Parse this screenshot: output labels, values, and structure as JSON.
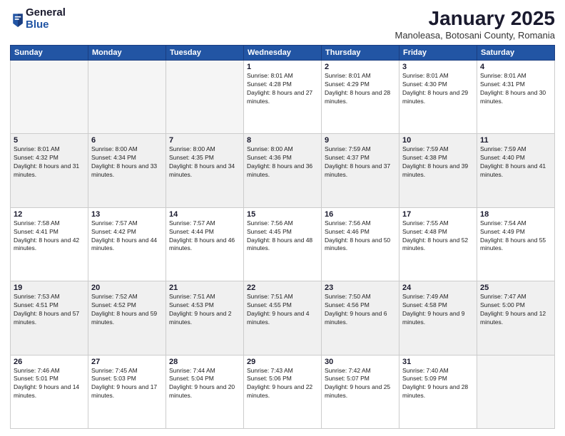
{
  "logo": {
    "general": "General",
    "blue": "Blue"
  },
  "header": {
    "month": "January 2025",
    "location": "Manoleasa, Botosani County, Romania"
  },
  "weekdays": [
    "Sunday",
    "Monday",
    "Tuesday",
    "Wednesday",
    "Thursday",
    "Friday",
    "Saturday"
  ],
  "weeks": [
    [
      {
        "day": "",
        "info": ""
      },
      {
        "day": "",
        "info": ""
      },
      {
        "day": "",
        "info": ""
      },
      {
        "day": "1",
        "info": "Sunrise: 8:01 AM\nSunset: 4:28 PM\nDaylight: 8 hours and 27 minutes."
      },
      {
        "day": "2",
        "info": "Sunrise: 8:01 AM\nSunset: 4:29 PM\nDaylight: 8 hours and 28 minutes."
      },
      {
        "day": "3",
        "info": "Sunrise: 8:01 AM\nSunset: 4:30 PM\nDaylight: 8 hours and 29 minutes."
      },
      {
        "day": "4",
        "info": "Sunrise: 8:01 AM\nSunset: 4:31 PM\nDaylight: 8 hours and 30 minutes."
      }
    ],
    [
      {
        "day": "5",
        "info": "Sunrise: 8:01 AM\nSunset: 4:32 PM\nDaylight: 8 hours and 31 minutes."
      },
      {
        "day": "6",
        "info": "Sunrise: 8:00 AM\nSunset: 4:34 PM\nDaylight: 8 hours and 33 minutes."
      },
      {
        "day": "7",
        "info": "Sunrise: 8:00 AM\nSunset: 4:35 PM\nDaylight: 8 hours and 34 minutes."
      },
      {
        "day": "8",
        "info": "Sunrise: 8:00 AM\nSunset: 4:36 PM\nDaylight: 8 hours and 36 minutes."
      },
      {
        "day": "9",
        "info": "Sunrise: 7:59 AM\nSunset: 4:37 PM\nDaylight: 8 hours and 37 minutes."
      },
      {
        "day": "10",
        "info": "Sunrise: 7:59 AM\nSunset: 4:38 PM\nDaylight: 8 hours and 39 minutes."
      },
      {
        "day": "11",
        "info": "Sunrise: 7:59 AM\nSunset: 4:40 PM\nDaylight: 8 hours and 41 minutes."
      }
    ],
    [
      {
        "day": "12",
        "info": "Sunrise: 7:58 AM\nSunset: 4:41 PM\nDaylight: 8 hours and 42 minutes."
      },
      {
        "day": "13",
        "info": "Sunrise: 7:57 AM\nSunset: 4:42 PM\nDaylight: 8 hours and 44 minutes."
      },
      {
        "day": "14",
        "info": "Sunrise: 7:57 AM\nSunset: 4:44 PM\nDaylight: 8 hours and 46 minutes."
      },
      {
        "day": "15",
        "info": "Sunrise: 7:56 AM\nSunset: 4:45 PM\nDaylight: 8 hours and 48 minutes."
      },
      {
        "day": "16",
        "info": "Sunrise: 7:56 AM\nSunset: 4:46 PM\nDaylight: 8 hours and 50 minutes."
      },
      {
        "day": "17",
        "info": "Sunrise: 7:55 AM\nSunset: 4:48 PM\nDaylight: 8 hours and 52 minutes."
      },
      {
        "day": "18",
        "info": "Sunrise: 7:54 AM\nSunset: 4:49 PM\nDaylight: 8 hours and 55 minutes."
      }
    ],
    [
      {
        "day": "19",
        "info": "Sunrise: 7:53 AM\nSunset: 4:51 PM\nDaylight: 8 hours and 57 minutes."
      },
      {
        "day": "20",
        "info": "Sunrise: 7:52 AM\nSunset: 4:52 PM\nDaylight: 8 hours and 59 minutes."
      },
      {
        "day": "21",
        "info": "Sunrise: 7:51 AM\nSunset: 4:53 PM\nDaylight: 9 hours and 2 minutes."
      },
      {
        "day": "22",
        "info": "Sunrise: 7:51 AM\nSunset: 4:55 PM\nDaylight: 9 hours and 4 minutes."
      },
      {
        "day": "23",
        "info": "Sunrise: 7:50 AM\nSunset: 4:56 PM\nDaylight: 9 hours and 6 minutes."
      },
      {
        "day": "24",
        "info": "Sunrise: 7:49 AM\nSunset: 4:58 PM\nDaylight: 9 hours and 9 minutes."
      },
      {
        "day": "25",
        "info": "Sunrise: 7:47 AM\nSunset: 5:00 PM\nDaylight: 9 hours and 12 minutes."
      }
    ],
    [
      {
        "day": "26",
        "info": "Sunrise: 7:46 AM\nSunset: 5:01 PM\nDaylight: 9 hours and 14 minutes."
      },
      {
        "day": "27",
        "info": "Sunrise: 7:45 AM\nSunset: 5:03 PM\nDaylight: 9 hours and 17 minutes."
      },
      {
        "day": "28",
        "info": "Sunrise: 7:44 AM\nSunset: 5:04 PM\nDaylight: 9 hours and 20 minutes."
      },
      {
        "day": "29",
        "info": "Sunrise: 7:43 AM\nSunset: 5:06 PM\nDaylight: 9 hours and 22 minutes."
      },
      {
        "day": "30",
        "info": "Sunrise: 7:42 AM\nSunset: 5:07 PM\nDaylight: 9 hours and 25 minutes."
      },
      {
        "day": "31",
        "info": "Sunrise: 7:40 AM\nSunset: 5:09 PM\nDaylight: 9 hours and 28 minutes."
      },
      {
        "day": "",
        "info": ""
      }
    ]
  ]
}
